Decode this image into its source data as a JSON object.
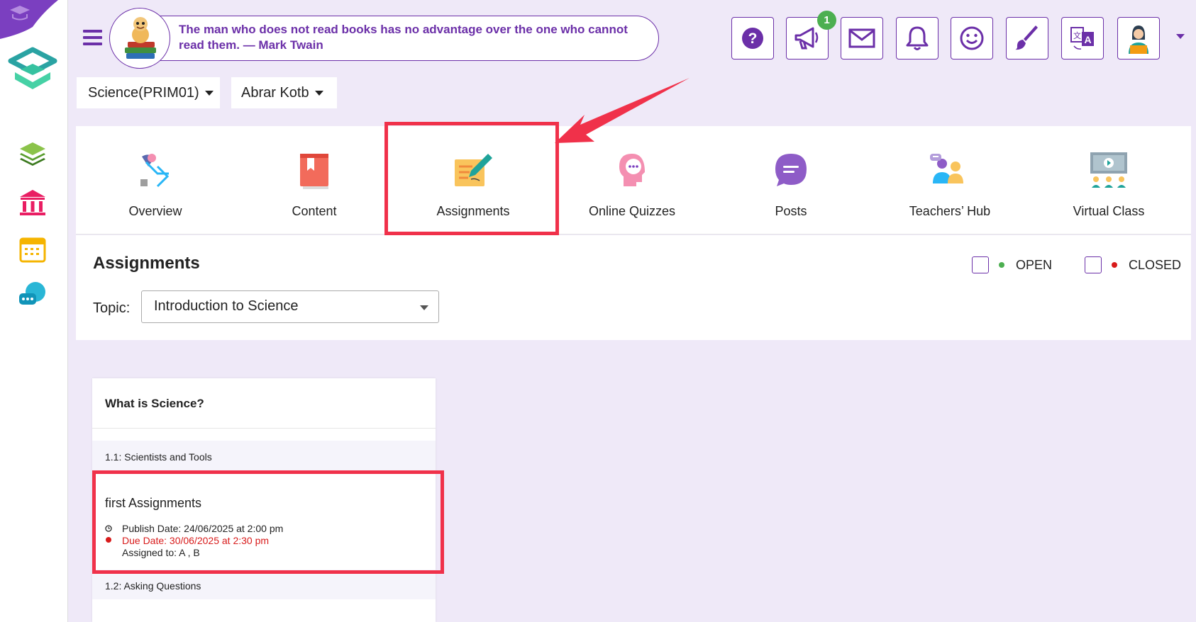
{
  "header": {
    "quote": "The man who does not read books has no advantage over the one who cannot read them. — Mark Twain",
    "notification_count": "1",
    "toolbar": [
      {
        "name": "help-button",
        "icon": "question-icon"
      },
      {
        "name": "announcements-button",
        "icon": "megaphone-icon"
      },
      {
        "name": "messages-button",
        "icon": "envelope-icon"
      },
      {
        "name": "notifications-button",
        "icon": "bell-icon"
      },
      {
        "name": "feedback-button",
        "icon": "smiley-icon"
      },
      {
        "name": "theme-button",
        "icon": "brush-icon"
      },
      {
        "name": "language-button",
        "icon": "translate-icon"
      },
      {
        "name": "profile-button",
        "icon": "user-avatar-icon"
      }
    ]
  },
  "breadcrumb": {
    "course": "Science(PRIM01)",
    "teacher": "Abrar Kotb"
  },
  "tabs": [
    {
      "label": "Overview",
      "icon": "overview-icon"
    },
    {
      "label": "Content",
      "icon": "book-icon"
    },
    {
      "label": "Assignments",
      "icon": "assignment-icon"
    },
    {
      "label": "Online Quizzes",
      "icon": "quiz-icon"
    },
    {
      "label": "Posts",
      "icon": "chat-bubble-icon"
    },
    {
      "label": "Teachers’ Hub",
      "icon": "teachers-hub-icon"
    },
    {
      "label": "Virtual Class",
      "icon": "virtual-class-icon"
    }
  ],
  "assignments": {
    "title": "Assignments",
    "topic_label": "Topic:",
    "topic_value": "Introduction to Science",
    "filters": {
      "open": "OPEN",
      "closed": "CLOSED"
    }
  },
  "card": {
    "title": "What is Science?",
    "section1": "1.1: Scientists and Tools",
    "item": {
      "title": "first Assignments",
      "publish": "Publish Date: 24/06/2025 at 2:00 pm",
      "due": "Due Date: 30/06/2025 at 2:30 pm",
      "assigned": "Assigned to: A , B"
    },
    "section2": "1.2: Asking Questions"
  },
  "colors": {
    "brand": "#6b2fa8",
    "highlight": "#f0314a",
    "open": "#4caf50",
    "closed": "#d81b1b",
    "background": "#efe9f8"
  }
}
